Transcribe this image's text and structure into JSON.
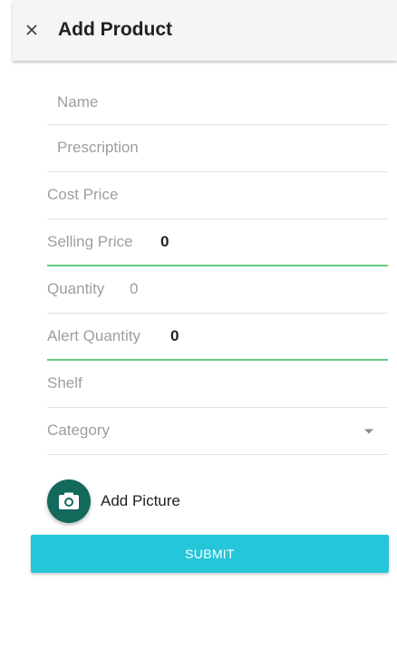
{
  "appbar": {
    "close_icon": "close-icon",
    "title": "Add Product"
  },
  "form": {
    "name": {
      "label": "Name",
      "value": ""
    },
    "prescription": {
      "label": "Prescription",
      "value": ""
    },
    "cost_price": {
      "label": "Cost Price",
      "value": ""
    },
    "selling_price": {
      "label": "Selling Price",
      "value": "0"
    },
    "quantity": {
      "label": "Quantity",
      "value": "0"
    },
    "alert_quantity": {
      "label": "Alert Quantity",
      "value": "0"
    },
    "shelf": {
      "label": "Shelf",
      "value": ""
    },
    "category": {
      "label": "Category",
      "value": "",
      "icon": "chevron-down-icon"
    }
  },
  "add_picture": {
    "label": "Add Picture",
    "icon": "camera-icon"
  },
  "submit": {
    "label": "SUBMIT"
  },
  "colors": {
    "accent_focus": "#66cc80",
    "fab": "#12695c",
    "submit": "#26c6da",
    "appbar": "#f5f5f5"
  }
}
